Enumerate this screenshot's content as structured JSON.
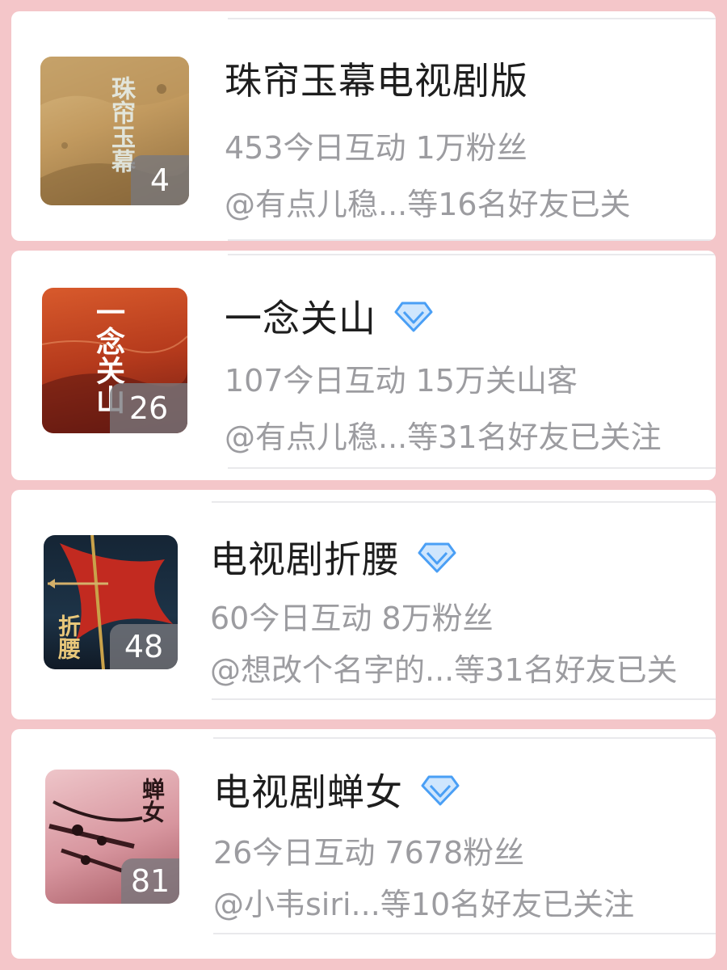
{
  "items": [
    {
      "title": "珠帘玉幕电视剧版",
      "verified": false,
      "badge": "4",
      "stats": "453今日互动 1万粉丝",
      "friends": "@有点儿稳...等16名好友已关",
      "cover_text": "珠帘玉幕",
      "cover_colors": [
        "#c9a46a",
        "#9b7a45"
      ]
    },
    {
      "title": "一念关山",
      "verified": true,
      "badge": "26",
      "stats": "107今日互动 15万关山客",
      "friends": "@有点儿稳...等31名好友已关注",
      "cover_text": "一念关山",
      "cover_colors": [
        "#c0431f",
        "#7e1d14"
      ]
    },
    {
      "title": "电视剧折腰",
      "verified": true,
      "badge": "48",
      "stats": "60今日互动 8万粉丝",
      "friends": "@想改个名字的...等31名好友已关",
      "cover_text": "折腰",
      "cover_colors": [
        "#1b2838",
        "#b7281f"
      ]
    },
    {
      "title": "电视剧蝉女",
      "verified": true,
      "badge": "81",
      "stats": "26今日互动 7678粉丝",
      "friends": "@小韦siri...等10名好友已关注",
      "cover_text": "蝉女",
      "cover_colors": [
        "#e2b3b9",
        "#8a3f48"
      ]
    }
  ],
  "colors": {
    "background": "#f4c6c9",
    "verified_blue": "#4a9ff5"
  }
}
